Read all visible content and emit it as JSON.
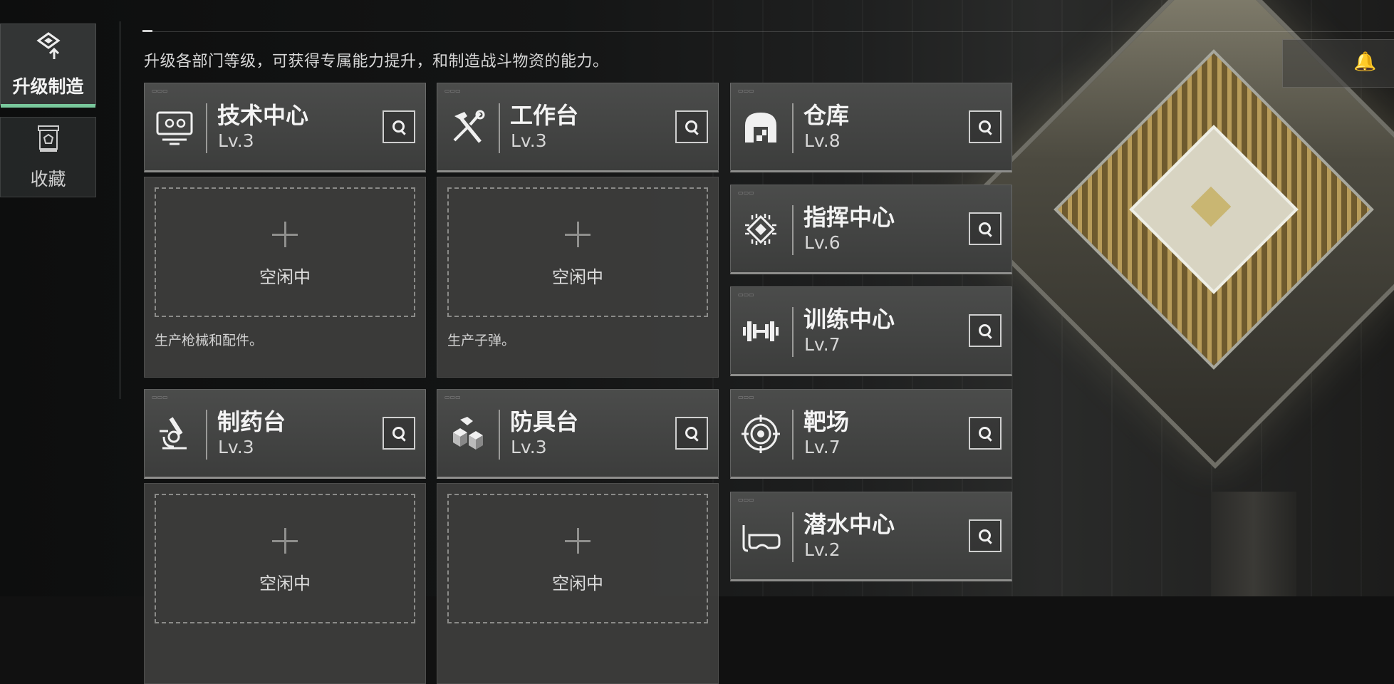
{
  "sidebar": {
    "items": [
      {
        "label": "升级制造",
        "icon": "upgrade-icon",
        "active": true
      },
      {
        "label": "收藏",
        "icon": "collection-icon",
        "active": false
      }
    ]
  },
  "header": {
    "description": "升级各部门等级，可获得专属能力提升，和制造战斗物资的能力。"
  },
  "departments": [
    {
      "name": "技术中心",
      "level": "Lv.3",
      "icon": "computer-icon"
    },
    {
      "name": "工作台",
      "level": "Lv.3",
      "icon": "hammer-wrench-icon"
    },
    {
      "name": "仓库",
      "level": "Lv.8",
      "icon": "warehouse-icon"
    },
    {
      "name": "指挥中心",
      "level": "Lv.6",
      "icon": "command-chip-icon"
    },
    {
      "name": "训练中心",
      "level": "Lv.7",
      "icon": "dumbbell-icon"
    },
    {
      "name": "制药台",
      "level": "Lv.3",
      "icon": "microscope-icon"
    },
    {
      "name": "防具台",
      "level": "Lv.3",
      "icon": "armor-blocks-icon"
    },
    {
      "name": "靶场",
      "level": "Lv.7",
      "icon": "target-icon"
    },
    {
      "name": "潜水中心",
      "level": "Lv.2",
      "icon": "diving-mask-icon"
    }
  ],
  "production": [
    {
      "status": "空闲中",
      "description": "生产枪械和配件。"
    },
    {
      "status": "空闲中",
      "description": "生产子弹。"
    },
    {
      "status": "空闲中",
      "description": ""
    },
    {
      "status": "空闲中",
      "description": ""
    }
  ],
  "colors": {
    "accent": "#79c89c",
    "card": "#454645",
    "panel": "#3e3e3d"
  }
}
